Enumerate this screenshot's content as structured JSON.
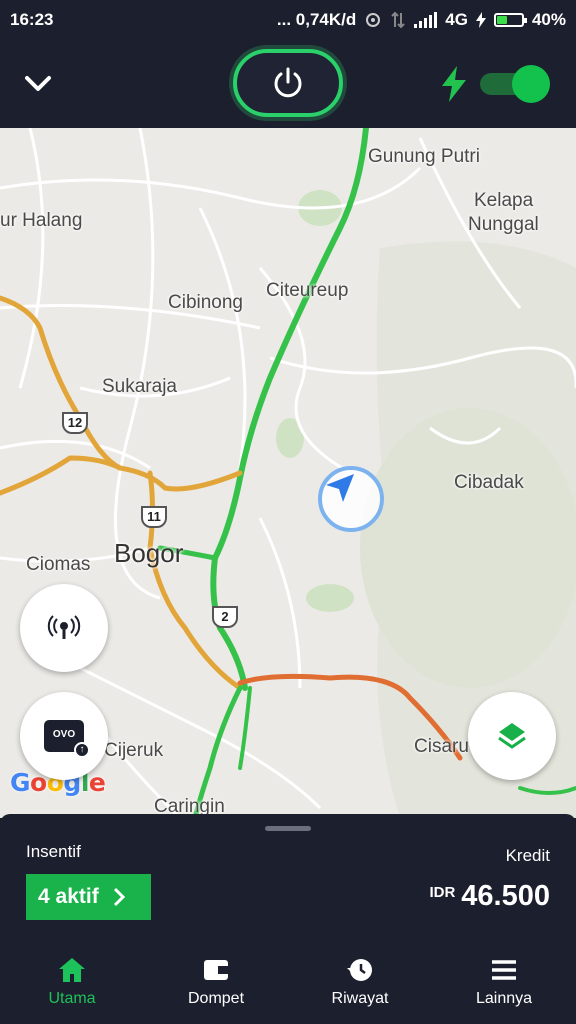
{
  "status_bar": {
    "time": "16:23",
    "speed": "... 0,74K/d",
    "network": "4G",
    "battery": "40%",
    "battery_level": 0.4
  },
  "header": {
    "collapse_icon": "chevron-down-icon",
    "power_icon": "power-icon",
    "bolt_icon": "bolt-icon",
    "online_toggle_on": true,
    "accent": "#2ad16a"
  },
  "map": {
    "places": [
      "Gunung Putri",
      "Kelapa",
      "Nunggal",
      "ur Halang",
      "Cibinong",
      "Citeureup",
      "Sukaraja",
      "Cibadak",
      "Ciomas",
      "Bogor",
      "Cijeruk",
      "Cisaru",
      "Caringin"
    ],
    "routes": [
      "12",
      "11",
      "2"
    ],
    "attribution": "Google"
  },
  "fabs": {
    "broadcast_icon": "broadcast-icon",
    "ovo_label": "OVO",
    "layers_icon": "layers-icon"
  },
  "sheet": {
    "incentive_label": "Insentif",
    "incentive_button": "4 aktif",
    "credit_label": "Kredit",
    "currency": "IDR",
    "credit_amount": "46.500"
  },
  "nav": {
    "items": [
      {
        "label": "Utama",
        "icon": "home-icon",
        "active": true
      },
      {
        "label": "Dompet",
        "icon": "wallet-icon",
        "active": false
      },
      {
        "label": "Riwayat",
        "icon": "history-icon",
        "active": false
      },
      {
        "label": "Lainnya",
        "icon": "menu-icon",
        "active": false
      }
    ]
  }
}
